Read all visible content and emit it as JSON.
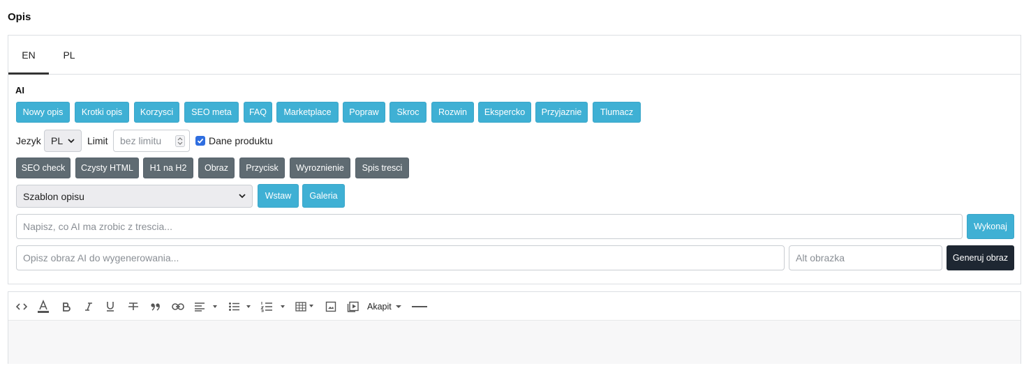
{
  "section": {
    "title": "Opis"
  },
  "tabs": [
    {
      "label": "EN",
      "active": true
    },
    {
      "label": "PL",
      "active": false
    }
  ],
  "ai": {
    "label": "AI",
    "actions": [
      "Nowy opis",
      "Krotki opis",
      "Korzysci",
      "SEO meta",
      "FAQ",
      "Marketplace",
      "Popraw",
      "Skroc",
      "Rozwin",
      "Ekspercko",
      "Przyjaznie",
      "Tlumacz"
    ],
    "language": {
      "label": "Jezyk",
      "value": "PL"
    },
    "limit": {
      "label": "Limit",
      "placeholder": "bez limitu"
    },
    "product_data": {
      "label": "Dane produktu",
      "checked": true
    },
    "tools": [
      "SEO check",
      "Czysty HTML",
      "H1 na H2",
      "Obraz",
      "Przycisk",
      "Wyroznienie",
      "Spis tresci"
    ],
    "template": {
      "value": "Szablon opisu",
      "insert_label": "Wstaw",
      "gallery_label": "Galeria"
    },
    "prompt": {
      "placeholder": "Napisz, co AI ma zrobic z trescia...",
      "run_label": "Wykonaj"
    },
    "image": {
      "placeholder": "Opisz obraz AI do wygenerowania...",
      "alt_placeholder": "Alt obrazka",
      "generate_label": "Generuj obraz"
    }
  },
  "editor": {
    "paragraph_label": "Akapit",
    "toolbar_icons": [
      "code-view-icon",
      "font-color-icon",
      "bold-icon",
      "italic-icon",
      "underline-icon",
      "strikethrough-icon",
      "blockquote-icon",
      "link-icon",
      "align-icon",
      "bulleted-list-icon",
      "numbered-list-icon",
      "table-icon",
      "image-icon",
      "video-icon",
      "paragraph-format-dropdown",
      "horizontal-line-icon"
    ]
  },
  "colors": {
    "info": "#3fb0d4",
    "secondary": "#5f6b72",
    "dark": "#1e2732",
    "checkbox": "#2f6ee0"
  }
}
